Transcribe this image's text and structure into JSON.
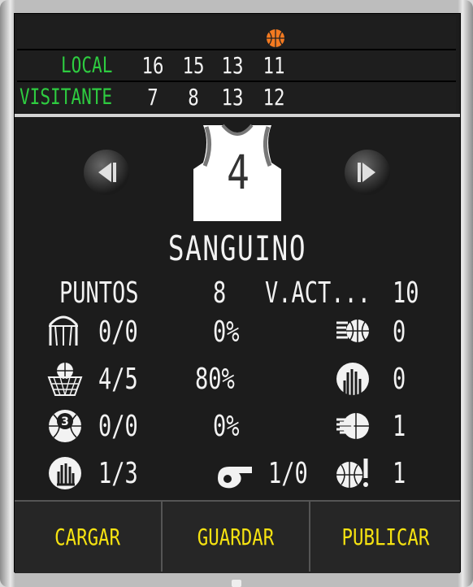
{
  "scoreboard": {
    "local_label": "LOCAL",
    "visitor_label": "VISITANTE",
    "local_quarters": [
      "16",
      "15",
      "13",
      "11"
    ],
    "visitor_quarters": [
      "7",
      "8",
      "13",
      "12"
    ],
    "possession_icon": "basketball-icon"
  },
  "player": {
    "name": "SANGUINO",
    "number": "4",
    "prev_icon": "previous-arrow-icon",
    "next_icon": "next-arrow-icon"
  },
  "stats": {
    "points_label": "PUNTOS",
    "points_value": "8",
    "val_label": "V.ACT...",
    "val_value": "10",
    "rows": [
      {
        "left_icon": "rim-icon",
        "made_att": "0/0",
        "pct": "0%",
        "right_icon": "fast-ball-icon",
        "right_value": "0"
      },
      {
        "left_icon": "basket-icon",
        "made_att": "4/5",
        "pct": "80%",
        "right_icon": "steal-hand-icon",
        "right_value": "0"
      },
      {
        "left_icon": "three-ball-icon",
        "made_att": "0/0",
        "pct": "0%",
        "right_icon": "hand-grab-ball-icon",
        "right_value": "1"
      },
      {
        "left_icon": "block-hand-icon",
        "made_att": "1/3",
        "pct": "",
        "right_icon": "ball-exclamation-icon",
        "right_value": "1"
      }
    ],
    "fouls_icon": "whistle-icon",
    "fouls_value": "1/0"
  },
  "buttons": {
    "load": "CARGAR",
    "save": "GUARDAR",
    "publish": "PUBLICAR"
  },
  "colors": {
    "team_label": "#2ecc40",
    "button_text": "#f5e211",
    "screen_bg": "#1c1c1c"
  }
}
